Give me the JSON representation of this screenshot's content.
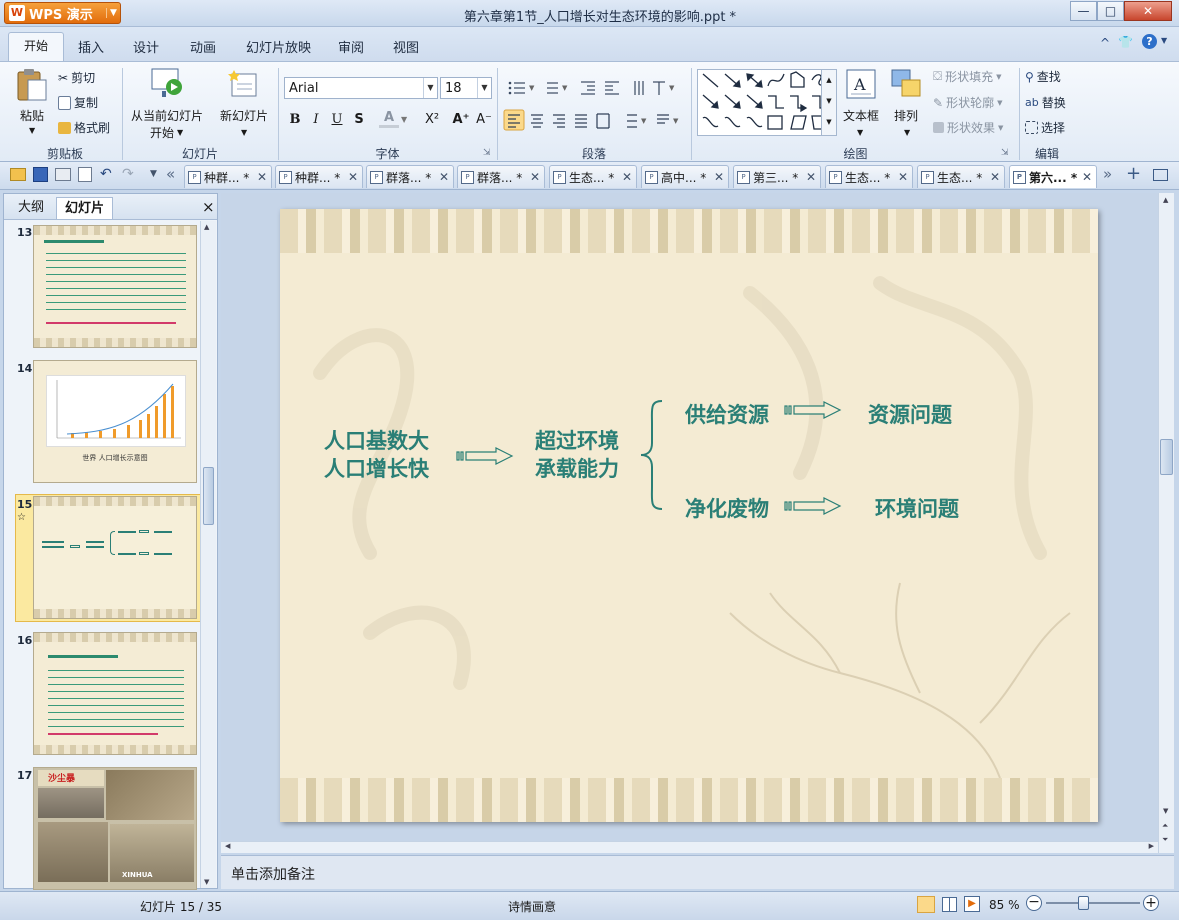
{
  "app": {
    "name": "WPS 演示",
    "window_title": "第六章第1节_人口增长对生态环境的影响.ppt *"
  },
  "window_buttons": {
    "minimize": "—",
    "maximize": "□",
    "close": "✕"
  },
  "menu": {
    "tabs": [
      "开始",
      "插入",
      "设计",
      "动画",
      "幻灯片放映",
      "审阅",
      "视图"
    ],
    "right_icons": [
      "^",
      "👕",
      "?"
    ]
  },
  "ribbon": {
    "clipboard": {
      "paste": "粘贴",
      "cut": "剪切",
      "copy": "复制",
      "format_painter": "格式刷",
      "label": "剪贴板"
    },
    "slides": {
      "from_current": "从当前幻灯片",
      "from_current2": "开始",
      "new_slide": "新幻灯片",
      "label": "幻灯片"
    },
    "font": {
      "name": "Arial",
      "size": "18",
      "bold": "B",
      "italic": "I",
      "underline": "U",
      "shadow": "S",
      "color": "A",
      "superscript": "X²",
      "grow": "A⁺",
      "shrink": "A⁻",
      "label": "字体"
    },
    "paragraph": {
      "label": "段落"
    },
    "drawing": {
      "text_box": "文本框",
      "arrange": "排列",
      "shape_fill": "形状填充",
      "shape_outline": "形状轮廓",
      "shape_effect": "形状效果",
      "label": "绘图"
    },
    "editing": {
      "find": "查找",
      "replace": "替换",
      "select": "选择",
      "label": "编辑"
    }
  },
  "doc_tabs": [
    "种群... *",
    "种群... *",
    "群落... *",
    "群落... *",
    "生态... *",
    "高中... *",
    "第三... *",
    "生态... *",
    "生态... *",
    "第六... *"
  ],
  "left_panel": {
    "tabs": [
      "大纲",
      "幻灯片"
    ],
    "close": "×",
    "thumbnails": [
      {
        "num": "13"
      },
      {
        "num": "14",
        "caption": "世界 人口增长示意图"
      },
      {
        "num": "15",
        "mark": "☆"
      },
      {
        "num": "16"
      },
      {
        "num": "17",
        "title": "沙尘暴",
        "tag": "XINHUA"
      }
    ]
  },
  "slide": {
    "left_line1": "人口基数大",
    "left_line2": "人口增长快",
    "mid_line1": "超过环境",
    "mid_line2": "承载能力",
    "branch1_cause": "供给资源",
    "branch1_effect": "资源问题",
    "branch2_cause": "净化废物",
    "branch2_effect": "环境问题"
  },
  "notes": {
    "placeholder": "单击添加备注"
  },
  "status": {
    "slide_counter": "幻灯片 15 / 35",
    "theme": "诗情画意",
    "zoom": "85 %"
  },
  "colors": {
    "slide_text": "#2a7f76",
    "slide_bg": "#f4ebd3",
    "app_orange": "#e26c0c",
    "chrome_blue": "#c6d6ea"
  }
}
